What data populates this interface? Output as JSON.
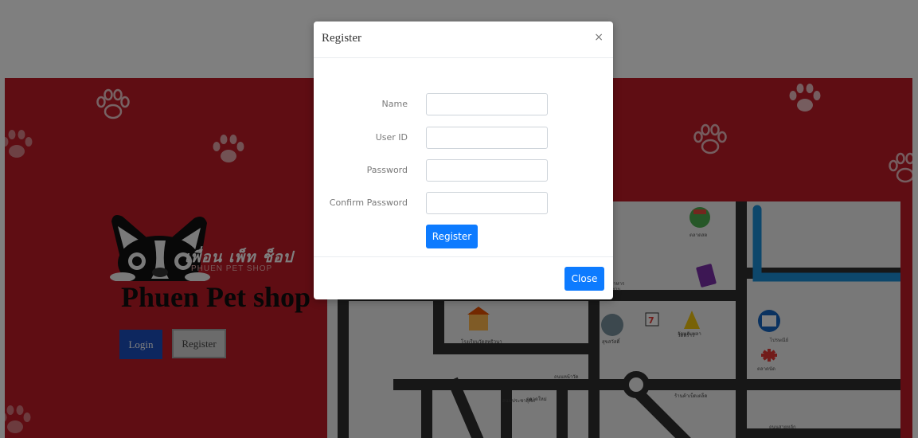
{
  "hero": {
    "logo_thai": "เพื่อน เพ็ท ช็อป",
    "logo_eng": "PHUEN PET SHOP",
    "title": "Phuen Pet shop",
    "login_label": "Login",
    "register_label": "Register"
  },
  "map": {
    "labels": [
      "ตลาดสด",
      "ถนนหลังโรงเรียน",
      "ร้านอาหาร",
      "ซอยทางเข้า",
      "โรงเรียนวัดสุทธิวนา",
      "สุขสวัสดิ์",
      "ถนนเลียบคลองชลประทาน",
      "วัดพลับพลา",
      "ถนนหน้าวัด",
      "ไปรษณีย์",
      "ร้านค้าเบ็ดเตล็ด",
      "ตลาดใหม่",
      "ตลาดนัด",
      "วัดพร้าว",
      "ถนนประชาอุทิศ",
      "ถนนสายหลัก"
    ]
  },
  "modal": {
    "title": "Register",
    "close_x": "×",
    "fields": [
      {
        "label": "Name",
        "value": ""
      },
      {
        "label": "User ID",
        "value": ""
      },
      {
        "label": "Password",
        "value": ""
      },
      {
        "label": "Confirm Password",
        "value": ""
      }
    ],
    "submit_label": "Register",
    "close_label": "Close"
  },
  "colors": {
    "hero_red": "#be1b27",
    "primary_blue": "#0d7bff",
    "map_road": "#2f2f2f",
    "map_canal": "#1a8fd6"
  }
}
